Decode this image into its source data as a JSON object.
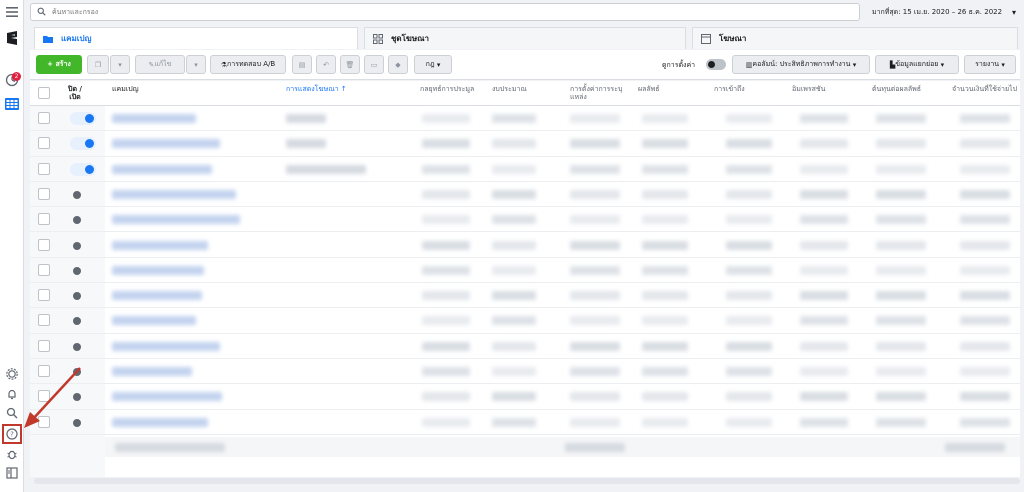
{
  "search": {
    "placeholder": "ค้นหาและกรอง"
  },
  "date_range": {
    "label": "มากที่สุด: 15 เม.ย. 2020 – 26 ธ.ค. 2022"
  },
  "tabs": [
    {
      "label": "แคมเปญ"
    },
    {
      "label": "ชุดโฆษณา"
    },
    {
      "label": "โฆษณา"
    }
  ],
  "toolbar": {
    "create_label": "+ สร้าง",
    "edit_label": "แก้ไข",
    "ab_test_label": "การทดสอบ A/B",
    "rules_label": "กฎ",
    "view_setup_label": "ดูการตั้งค่า",
    "columns_label": "คอลัมน์: ประสิทธิภาพการทำงาน",
    "breakdown_label": "ข้อมูลแยกย่อย",
    "reports_label": "รายงาน"
  },
  "table": {
    "headers": [
      "ปิด / เปิด",
      "แคมเปญ",
      "การแสดงโฆษณา ↑",
      "กลยุทธ์การประมูล",
      "งบประมาณ",
      "การตั้งค่าการระบุแหล่ง",
      "ผลลัพธ์",
      "การเข้าถึง",
      "อิมเพรสชัน",
      "ต้นทุนต่อผลลัพธ์",
      "จำนวนเงินที่ใช้จ่ายไป"
    ],
    "active_rows": 3,
    "total_rows": 13
  },
  "icons": {
    "menu": "menu-icon",
    "search": "search-icon",
    "settings": "gear-icon",
    "notifications": "bell-icon",
    "help": "help-icon",
    "bug": "bug-icon",
    "panel": "panel-icon"
  },
  "colors": {
    "accent": "#1877f2",
    "create": "#42b72a",
    "annotation": "#c0392b"
  }
}
